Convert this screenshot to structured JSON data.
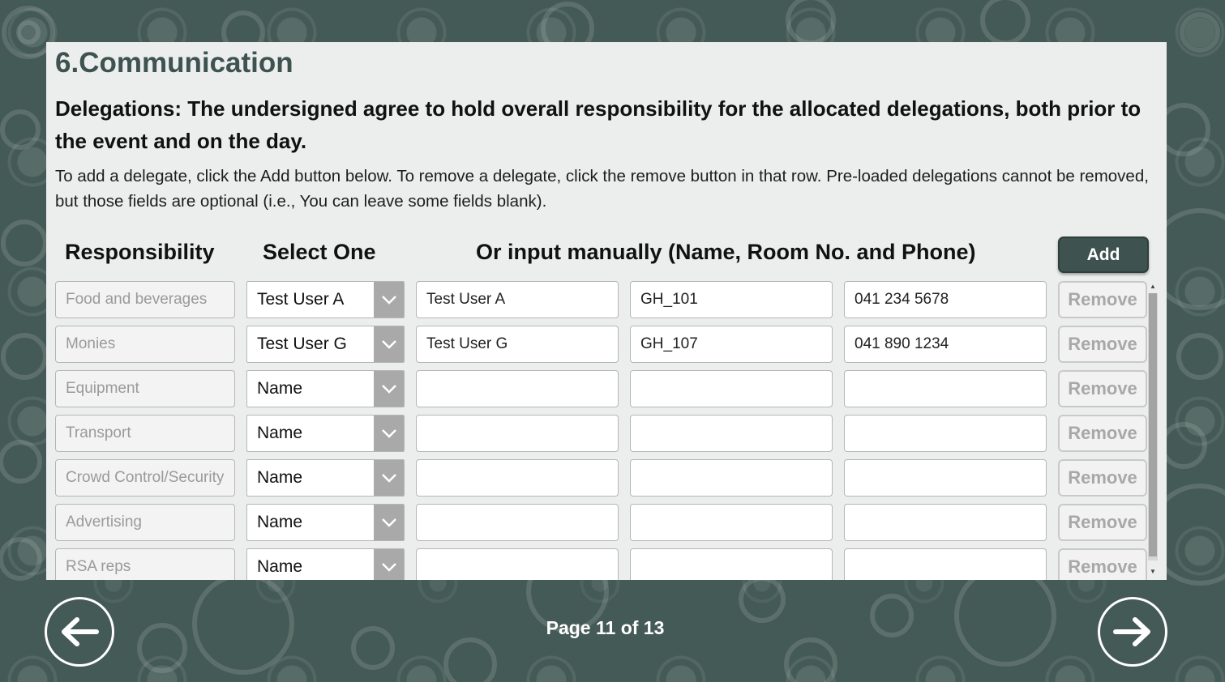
{
  "section_title": "6.Communication",
  "subtitle": "Delegations: The undersigned agree to hold overall responsibility for the allocated delegations, both prior to the event and on the day.",
  "instructions": "To add a delegate, click the Add button below. To remove a delegate, click the remove button in that row. Pre-loaded delegations cannot be removed, but those fields are optional (i.e., You can leave some fields blank).",
  "headers": {
    "responsibility": "Responsibility",
    "select_one": "Select One",
    "manual": "Or input manually (Name, Room No. and Phone)"
  },
  "add_label": "Add",
  "rows": [
    {
      "responsibility": "Food and beverages",
      "select": "Test User A",
      "name": "Test User A",
      "room": "GH_101",
      "phone": "041 234 5678",
      "remove": "Remove"
    },
    {
      "responsibility": "Monies",
      "select": "Test User G",
      "name": "Test User G",
      "room": "GH_107",
      "phone": "041 890 1234",
      "remove": "Remove"
    },
    {
      "responsibility": "Equipment",
      "select": "Name",
      "name": "",
      "room": "",
      "phone": "",
      "remove": "Remove"
    },
    {
      "responsibility": "Transport",
      "select": "Name",
      "name": "",
      "room": "",
      "phone": "",
      "remove": "Remove"
    },
    {
      "responsibility": "Crowd Control/Security",
      "select": "Name",
      "name": "",
      "room": "",
      "phone": "",
      "remove": "Remove"
    },
    {
      "responsibility": "Advertising",
      "select": "Name",
      "name": "",
      "room": "",
      "phone": "",
      "remove": "Remove"
    },
    {
      "responsibility": "RSA reps",
      "select": "Name",
      "name": "",
      "room": "",
      "phone": "",
      "remove": "Remove"
    }
  ],
  "page_indicator": "Page 11 of 13",
  "icons": {
    "prev": "arrow-left-icon",
    "next": "arrow-right-icon",
    "dropdown": "chevron-down-icon"
  },
  "colors": {
    "background": "#445a56",
    "panel": "#eceeed",
    "accent": "#3e524f"
  }
}
